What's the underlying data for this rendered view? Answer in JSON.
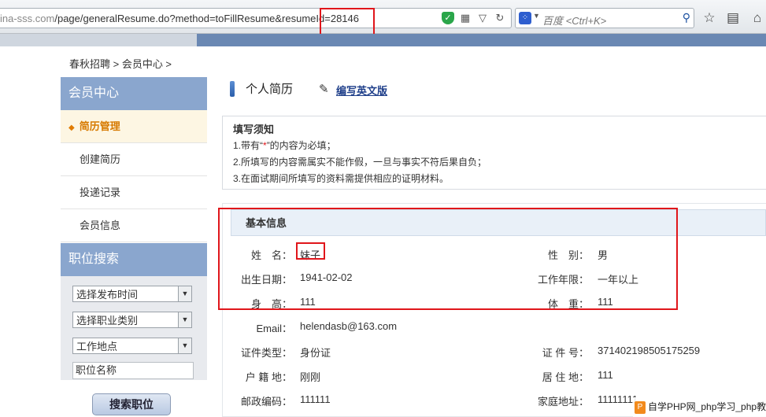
{
  "browser": {
    "url_prefix": "ina-sss.com",
    "url_path": "/page/generalResume.do?method=toFillResume&resumeId=28146",
    "search_placeholder": "百度 <Ctrl+K>",
    "icons": [
      "shield-icon",
      "qr-icon",
      "dropdown-icon",
      "reload-icon",
      "baidu-icon",
      "search-icon",
      "star-icon",
      "bookmarks-icon",
      "home-icon"
    ]
  },
  "breadcrumb": "春秋招聘 > 会员中心 >",
  "sidebar": {
    "member_center": "会员中心",
    "items": [
      {
        "label": "简历管理",
        "active": true
      },
      {
        "label": "创建简历",
        "active": false
      },
      {
        "label": "投递记录",
        "active": false
      },
      {
        "label": "会员信息",
        "active": false
      }
    ],
    "job_search": "职位搜索",
    "selects": [
      "选择发布时间",
      "选择职业类别",
      "工作地点"
    ],
    "keyword_placeholder": "职位名称",
    "search_button": "搜索职位"
  },
  "main": {
    "title": "个人简历",
    "english_link": "编写英文版",
    "notice_title": "填写须知",
    "notice_lines": [
      "1.带有“*”的内容为必填；",
      "2.所填写的内容需属实不能作假，一旦与事实不符后果自负；",
      "3.在面试期间所填写的资料需提供相应的证明材料。"
    ],
    "section_title": "基本信息",
    "fields": [
      {
        "label": "姓　名：",
        "value": "妹子"
      },
      {
        "label": "性　别：",
        "value": "男"
      },
      {
        "label": "出生日期：",
        "value": "1941-02-02"
      },
      {
        "label": "工作年限：",
        "value": "一年以上"
      },
      {
        "label": "身　高：",
        "value": "111"
      },
      {
        "label": "体　重：",
        "value": "111"
      },
      {
        "label": "Email：",
        "value": "helendasb@163.com"
      },
      {
        "label": "证件类型：",
        "value": "身份证"
      },
      {
        "label": "证 件 号：",
        "value": "371402198505175259"
      },
      {
        "label": "户 籍 地：",
        "value": "刚刚"
      },
      {
        "label": "居 住 地：",
        "value": "111"
      },
      {
        "label": "邮政编码：",
        "value": "111111"
      },
      {
        "label": "家庭地址：",
        "value": "11111111"
      }
    ]
  },
  "watermark": "自学PHP网_php学习_php教程"
}
